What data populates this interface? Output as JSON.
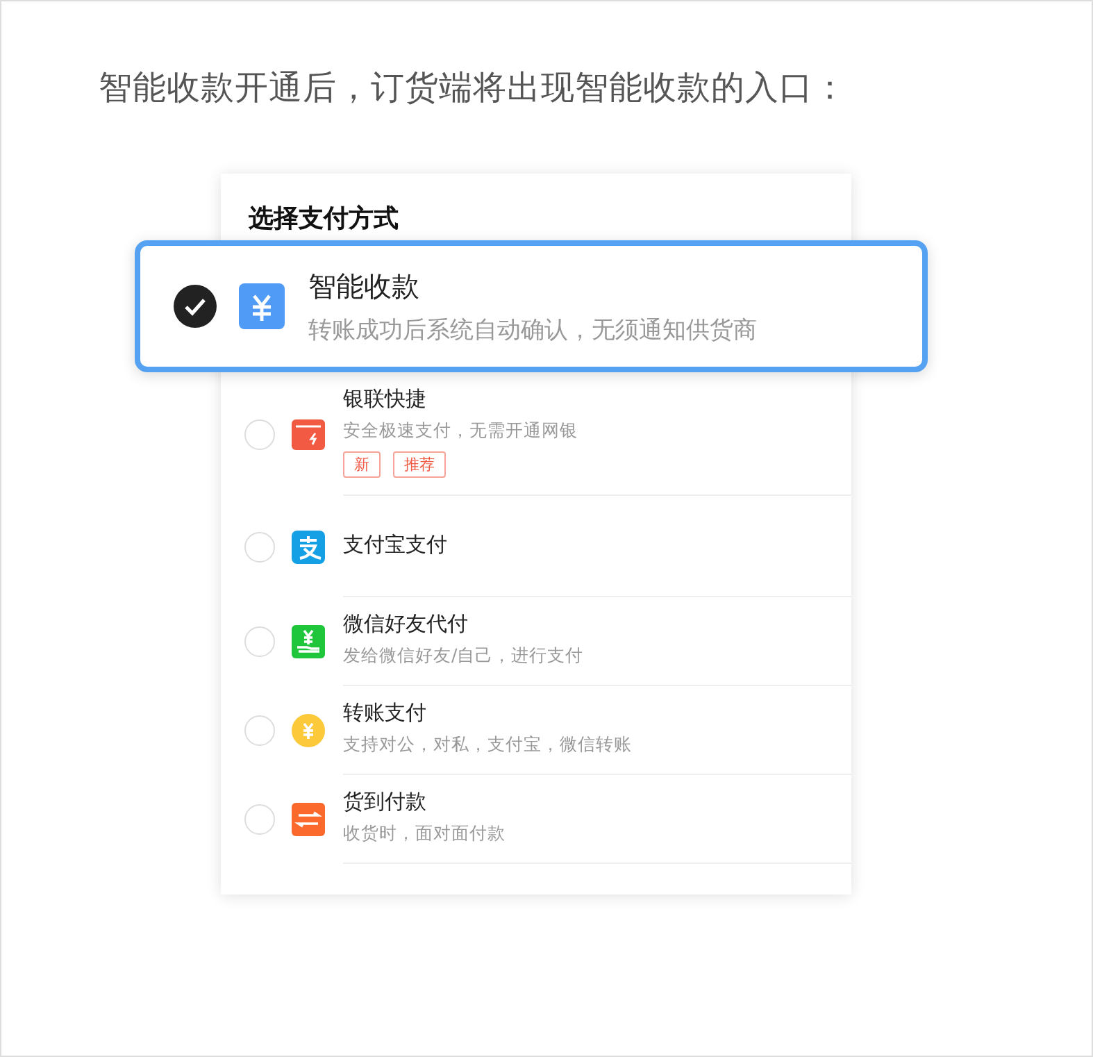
{
  "intro": "智能收款开通后，订货端将出现智能收款的入口：",
  "panel": {
    "title": "选择支付方式",
    "methods": [
      {
        "kind": "smart",
        "name": "智能收款",
        "description": "转账成功后系统自动确认，无须通知供货商",
        "selected": true
      },
      {
        "kind": "unionpay",
        "name": "银联快捷",
        "description": "安全极速支付，无需开通网银",
        "tags": [
          "新",
          "推荐"
        ],
        "selected": false
      },
      {
        "kind": "alipay",
        "name": "支付宝支付",
        "selected": false
      },
      {
        "kind": "wechat",
        "name": "微信好友代付",
        "description": "发给微信好友/自己，进行支付",
        "selected": false
      },
      {
        "kind": "transfer",
        "name": "转账支付",
        "description": "支持对公，对私，支付宝，微信转账",
        "selected": false
      },
      {
        "kind": "cod",
        "name": "货到付款",
        "description": "收货时，面对面付款",
        "selected": false
      }
    ]
  }
}
